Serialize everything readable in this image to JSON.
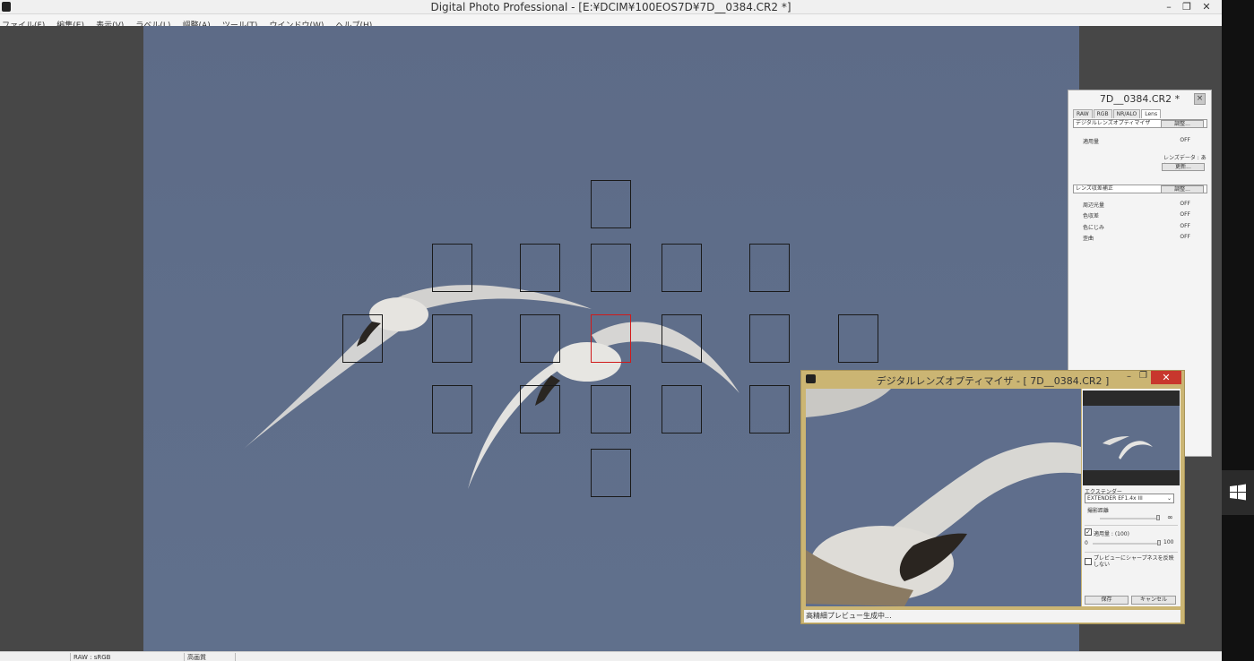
{
  "window": {
    "title": "Digital Photo Professional - [E:¥DCIM¥100EOS7D¥7D__0384.CR2 *]",
    "minimize": "–",
    "restore": "❐",
    "close": "✕"
  },
  "menu": [
    "ファイル(F)",
    "編集(E)",
    "表示(V)",
    "ラベル(L)",
    "調整(A)",
    "ツール(T)",
    "ウインドウ(W)",
    "ヘルプ(H)"
  ],
  "statusbar": {
    "color_space": "RAW : sRGB",
    "quality": "高画質"
  },
  "palette": {
    "title": "7D__0384.CR2 *",
    "close": "×",
    "tabs": [
      "RAW",
      "RGB",
      "NR/ALO",
      "Lens"
    ],
    "selected_tab": "Lens",
    "dlo_section": "デジタルレンズオプティマイザ",
    "adjust_label": "調整...",
    "apply_amount_label": "適用量",
    "apply_amount_value": "OFF",
    "lens_data": "レンズデータ : あり",
    "update_label": "更新...",
    "aberration_section": "レンズ収差補正",
    "aberration_rows": [
      {
        "label": "周辺光量",
        "value": "OFF"
      },
      {
        "label": "色収差",
        "value": "OFF"
      },
      {
        "label": "色にじみ",
        "value": "OFF"
      },
      {
        "label": "歪曲",
        "value": "OFF"
      }
    ]
  },
  "dlo_dialog": {
    "title": "デジタルレンズオプティマイザ - [ 7D__0384.CR2 ]",
    "extender_label": "エクステンダー",
    "extender_value": "EXTENDER EF1.4x III",
    "distance_label": "撮影距離",
    "distance_infinity": "∞",
    "apply_check_label": "適用量 : (100)",
    "apply_checked": true,
    "apply_min": "0",
    "apply_max": "100",
    "sharpness_label": "プレビューにシャープネスを反映しない",
    "sharpness_checked": false,
    "save_label": "保存",
    "cancel_label": "キャンセル",
    "status": "高精細プレビュー生成中..."
  },
  "colors": {
    "sky": "#5f6e8a",
    "af_active": "#d01a1a",
    "dialog_frame": "#cbb573",
    "close_red": "#c8372d"
  }
}
